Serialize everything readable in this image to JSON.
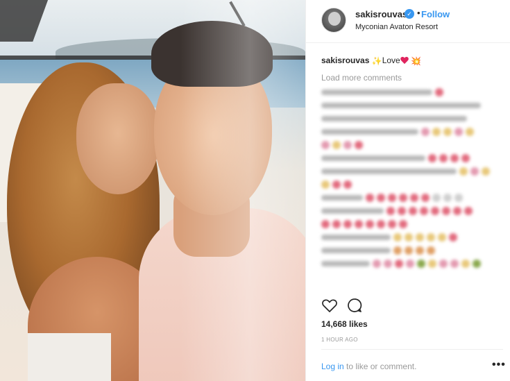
{
  "post": {
    "username": "sakisrouvas",
    "verified_badge": "✓",
    "separator": "•",
    "follow_label": "Follow",
    "location": "Myconian Avaton Resort"
  },
  "caption": {
    "username": "sakisrouvas",
    "text": "Love"
  },
  "comments": {
    "load_more_label": "Load more comments"
  },
  "engagement": {
    "likes": "14,668 likes",
    "timestamp": "1 HOUR AGO"
  },
  "footer": {
    "login_label": "Log in",
    "suffix": " to like or comment.",
    "more_label": "•••"
  },
  "colors": {
    "accent": "#3897f0",
    "text": "#262626",
    "muted": "#999999",
    "heart": "#e0245e"
  },
  "icons": [
    "verified-icon",
    "heart-outline-icon",
    "comment-bubble-icon",
    "more-options-icon"
  ]
}
